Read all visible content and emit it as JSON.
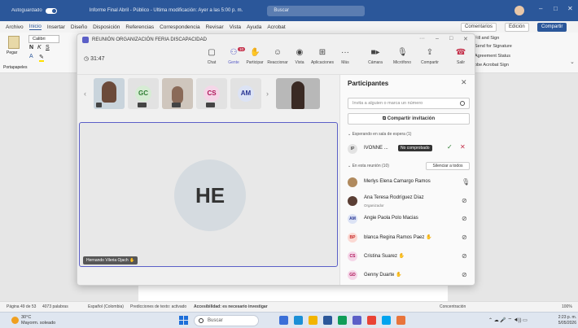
{
  "word": {
    "title_bar": {
      "autosave": "Autoguardado",
      "document": "Informe Final Abril - Público - Última modificación: Ayer a las 5:00 p. m.",
      "search_placeholder": "Buscar"
    },
    "menu": [
      "Archivo",
      "Inicio",
      "Insertar",
      "Diseño",
      "Disposición",
      "Referencias",
      "Correspondencia",
      "Revisar",
      "Vista",
      "Ayuda",
      "Acrobat"
    ],
    "comments_button": "Comentarios",
    "editing_button": "Edición",
    "share_button": "Compartir",
    "ribbon": {
      "paste": "Pegar",
      "font_name": "Calibri",
      "clipboard": "Portapapeles"
    },
    "addins": [
      "Fill and Sign",
      "Send for Signature",
      "Agreement Status",
      "obe Acrobat Sign"
    ],
    "status_bar": {
      "page": "Página 49 de 53",
      "words": "4073 palabras",
      "language": "Español (Colombia)",
      "predictions": "Predicciones de texto: activado",
      "accessibility": "Accesibilidad: es necesario investigar",
      "focus": "Concentración",
      "zoom": "100%"
    }
  },
  "taskbar": {
    "weather_temp": "30°C",
    "weather_desc": "Mayorm. soleado",
    "search_placeholder": "Buscar",
    "time": "2:23 p. m.",
    "date": "5/05/2026"
  },
  "teams": {
    "window_title": "REUNIÓN ORGANIZACIÓN FERIA DISCAPACIDAD",
    "timer": "31:47",
    "toolbar": [
      {
        "label": "Chat",
        "icon": "chat-icon"
      },
      {
        "label": "Gente",
        "icon": "people-icon"
      },
      {
        "label": "Participar",
        "icon": "raise-hand-icon"
      },
      {
        "label": "Reaccionar",
        "icon": "react-icon"
      },
      {
        "label": "Vista",
        "icon": "view-icon"
      },
      {
        "label": "Aplicaciones",
        "icon": "apps-icon"
      },
      {
        "label": "Más",
        "icon": "more-icon"
      },
      {
        "label": "Cámara",
        "icon": "camera-icon"
      },
      {
        "label": "Micrófono",
        "icon": "mic-icon"
      },
      {
        "label": "Compartir",
        "icon": "share-icon"
      },
      {
        "label": "Salir",
        "icon": "leave-icon"
      }
    ],
    "people_badge": "10",
    "thumbnails": [
      {
        "initials": "",
        "kind": "photo"
      },
      {
        "initials": "GC",
        "bg": "#d6ecd4",
        "fg": "#2e7d32"
      },
      {
        "initials": "",
        "kind": "photo"
      },
      {
        "initials": "CS",
        "bg": "#f5d6e8",
        "fg": "#ad1457"
      },
      {
        "initials": "AM",
        "bg": "#dce3f5",
        "fg": "#283593"
      }
    ],
    "main_speaker_initials": "HE",
    "main_speaker_name": "Hernando Vileria Ojach",
    "participants_panel": {
      "title": "Participantes",
      "invite_placeholder": "Invita a alguien o marca un número",
      "share_invite": "Compartir invitación",
      "waiting_section": "Esperando en sala de espera (1)",
      "waiting": {
        "initials": "IP",
        "name": "IVONNE ...",
        "badge": "No comprobado"
      },
      "in_meeting_section": "En esta reunión (10)",
      "mute_all": "Silenciar a todos",
      "members": [
        {
          "name": "Merlys Elena Camargo Ramos",
          "role": "",
          "initials": "",
          "photo": true,
          "mic": "on"
        },
        {
          "name": "Ana Teresa Rodríguez Díaz",
          "role": "Organizador",
          "initials": "",
          "photo": true,
          "mic": "off"
        },
        {
          "name": "Angie Paola Polo Macias",
          "role": "",
          "initials": "AM",
          "bg": "#dce3f5",
          "fg": "#283593",
          "mic": "off"
        },
        {
          "name": "blanca Regina Ramos Paez",
          "role": "",
          "initials": "BP",
          "bg": "#fbd9d3",
          "fg": "#c62828",
          "mic": "off"
        },
        {
          "name": "Cristina Suarez",
          "role": "",
          "initials": "CS",
          "bg": "#f5d6e8",
          "fg": "#ad1457",
          "mic": "off"
        },
        {
          "name": "Genny Duarte",
          "role": "",
          "initials": "GD",
          "bg": "#f5d6e8",
          "fg": "#ad1457",
          "mic": "off"
        }
      ]
    }
  }
}
